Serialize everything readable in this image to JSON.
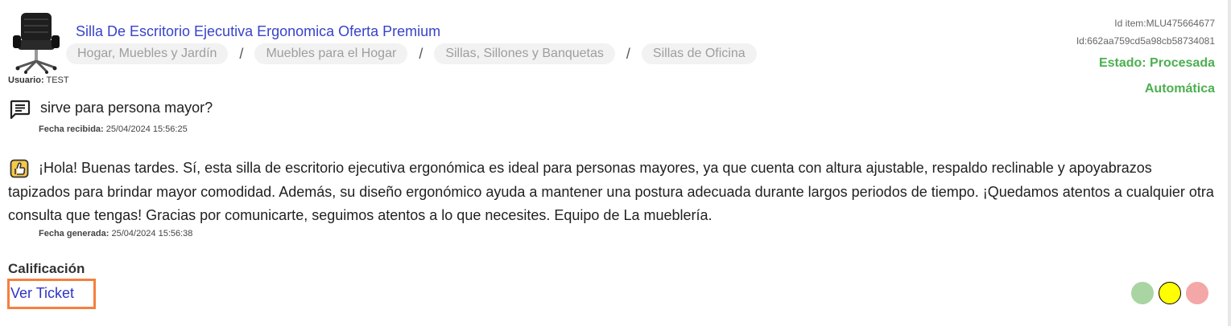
{
  "item": {
    "title": "Silla De Escritorio Ejecutiva Ergonomica Oferta Premium",
    "breadcrumbs": [
      "Hogar, Muebles y Jardín",
      "Muebles para el Hogar",
      "Sillas, Sillones y Banquetas",
      "Sillas de Oficina"
    ],
    "breadcrumb_separator": "/",
    "user_label": "Usuario:",
    "user_value": "TEST"
  },
  "meta": {
    "id_item": "Id item:MLU475664677",
    "id": "Id:662aa759cd5a98cb58734081",
    "estado_line1": "Estado: Procesada",
    "estado_line2": "Automática",
    "estado_color": "#4caf50"
  },
  "question": {
    "icon": "chat-message-icon",
    "text": "sirve para persona mayor?",
    "date_label": "Fecha recibida:",
    "date_value": "25/04/2024 15:56:25"
  },
  "answer": {
    "icon": "robot-thumbs-up-icon",
    "text": "¡Hola! Buenas tardes. Sí, esta silla de escritorio ejecutiva ergonómica es ideal para personas mayores, ya que cuenta con altura ajustable, respaldo reclinable y apoyabrazos tapizados para brindar mayor comodidad. Además, su diseño ergonómico ayuda a mantener una postura adecuada durante largos periodos de tiempo. ¡Quedamos atentos a cualquier otra consulta que tengas! Gracias por comunicarte, seguimos atentos a lo que necesites. Equipo de La mueblería.",
    "date_label": "Fecha generada:",
    "date_value": "25/04/2024 15:56:38"
  },
  "rating": {
    "label": "Calificación",
    "ver_ticket": "Ver Ticket",
    "options": [
      {
        "name": "rating-green",
        "color": "#a8d5a2",
        "selected": false
      },
      {
        "name": "rating-yellow",
        "color": "#ffff00",
        "selected": true
      },
      {
        "name": "rating-red",
        "color": "#f4a7a7",
        "selected": false
      }
    ],
    "highlight_color": "#f5803e"
  }
}
